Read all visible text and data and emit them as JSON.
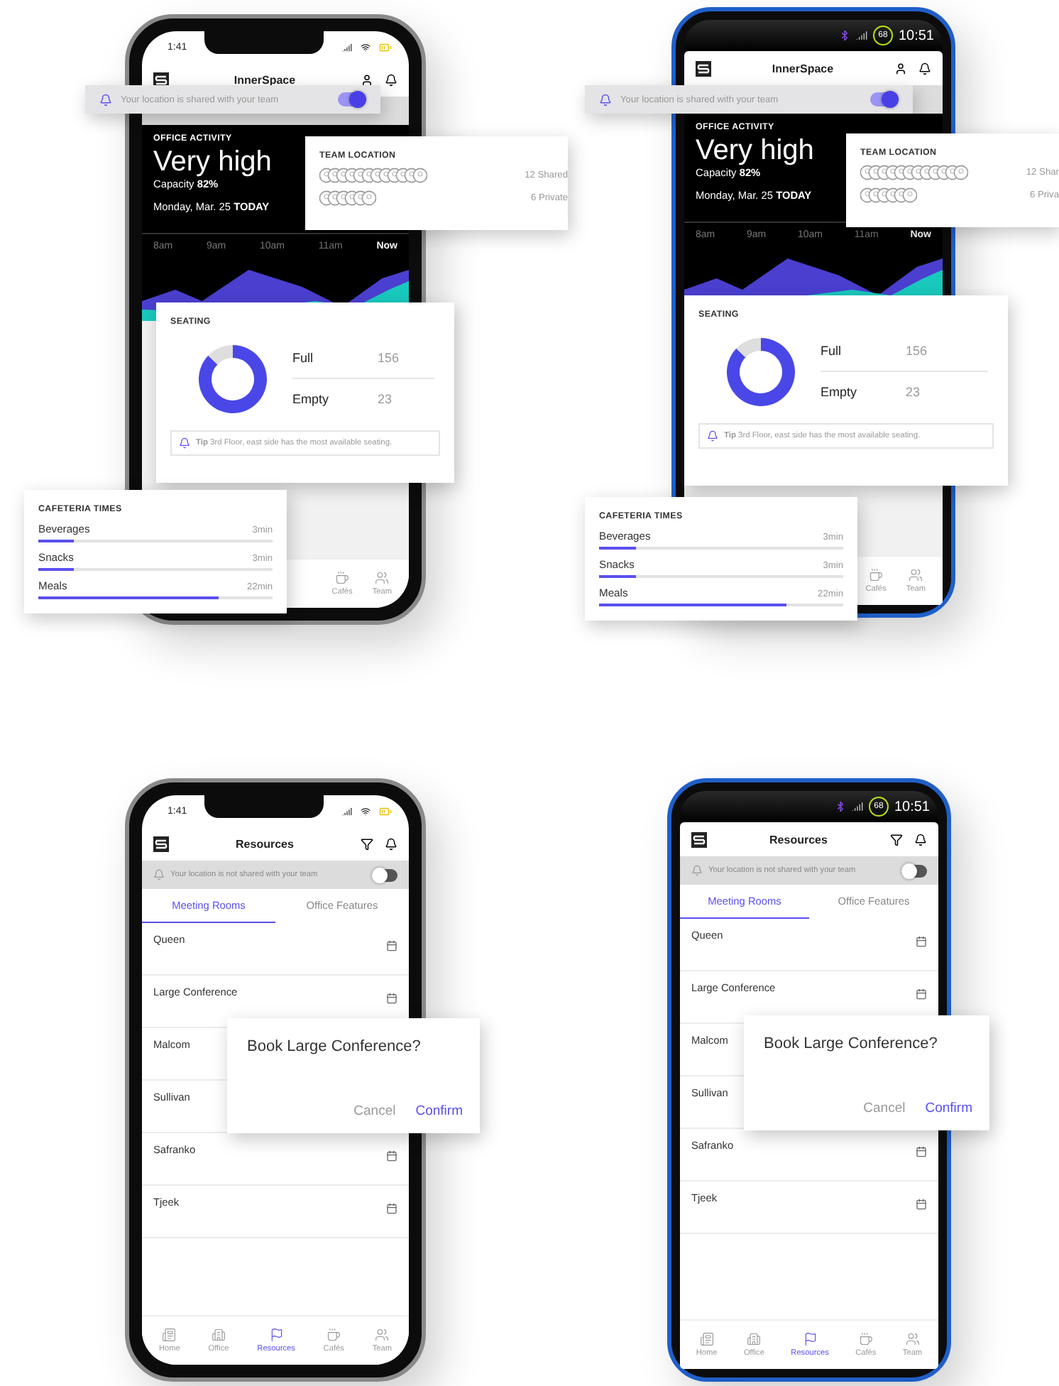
{
  "screens": [
    {
      "kind": "dashboard",
      "device": {
        "kind": "iphone"
      },
      "status_time": "1:41",
      "app_title": "InnerSpace",
      "share_banner": {
        "text": "Your location is shared with your team",
        "on": true
      },
      "activity": {
        "label": "OFFICE ACTIVITY",
        "value": "Very high",
        "capacity_label": "Capacity",
        "capacity": "82%",
        "date": "Monday, Mar. 25",
        "today": "TODAY",
        "hours": [
          "8am",
          "9am",
          "10am",
          "11am",
          "Now"
        ]
      },
      "team_location": {
        "title": "TEAM LOCATION",
        "groups": [
          "12 Shared",
          "6 Private"
        ]
      },
      "seating": {
        "title": "SEATING",
        "rows": [
          {
            "label": "Full",
            "value": "156"
          },
          {
            "label": "Empty",
            "value": "23"
          }
        ],
        "tip_label": "Tip",
        "tip": "3rd Floor, east side has the most available seating."
      },
      "cafeteria": {
        "title": "CAFETERIA TIMES",
        "items": [
          {
            "name": "Beverages",
            "time": "3min",
            "level": 0.15
          },
          {
            "name": "Snacks",
            "time": "3min",
            "level": 0.15
          },
          {
            "name": "Meals",
            "time": "22min",
            "level": 0.77
          }
        ]
      },
      "nav": [
        {
          "label": "Cafés",
          "selected": false
        },
        {
          "label": "Team",
          "selected": false
        }
      ]
    },
    {
      "kind": "dashboard",
      "device": {
        "kind": "android"
      },
      "status_time": "10:51",
      "battery": "68",
      "app_title": "InnerSpace",
      "share_banner": {
        "text": "Your location is shared with your team",
        "on": true
      },
      "activity": {
        "label": "OFFICE ACTIVITY",
        "value": "Very high",
        "capacity_label": "Capacity",
        "capacity": "82%",
        "date": "Monday, Mar. 25",
        "today": "TODAY",
        "hours": [
          "8am",
          "9am",
          "10am",
          "11am",
          "Now"
        ]
      },
      "team_location": {
        "title": "TEAM LOCATION",
        "groups": [
          "12 Shar",
          "6 Priva"
        ]
      },
      "seating": {
        "title": "SEATING",
        "rows": [
          {
            "label": "Full",
            "value": "156"
          },
          {
            "label": "Empty",
            "value": "23"
          }
        ],
        "tip_label": "Tip",
        "tip": "3rd Floor, east side has the most available seating."
      },
      "cafeteria": {
        "title": "CAFETERIA TIMES",
        "items": [
          {
            "name": "Beverages",
            "time": "3min",
            "level": 0.15
          },
          {
            "name": "Snacks",
            "time": "3min",
            "level": 0.15
          },
          {
            "name": "Meals",
            "time": "22min",
            "level": 0.77
          }
        ]
      },
      "nav": [
        {
          "label": "Cafés",
          "selected": false
        },
        {
          "label": "Team",
          "selected": false
        }
      ]
    },
    {
      "kind": "resources",
      "device": {
        "kind": "iphone"
      },
      "status_time": "1:41",
      "app_title": "Resources",
      "share_banner": {
        "text": "Your location is not shared with your team",
        "on": false
      },
      "tabs": [
        {
          "label": "Meeting Rooms",
          "selected": true
        },
        {
          "label": "Office Features",
          "selected": false
        }
      ],
      "rooms": [
        {
          "name": "Queen",
          "calendar": true
        },
        {
          "name": "Large Conference",
          "calendar": true
        },
        {
          "name": "Malcom",
          "calendar": false
        },
        {
          "name": "Sullivan",
          "calendar": false
        },
        {
          "name": "Safranko",
          "calendar": true
        },
        {
          "name": "Tjeek",
          "calendar": true
        }
      ],
      "dialog": {
        "title": "Book Large Conference?",
        "cancel": "Cancel",
        "confirm": "Confirm"
      },
      "nav": [
        {
          "label": "Home",
          "selected": false
        },
        {
          "label": "Office",
          "selected": false
        },
        {
          "label": "Resources",
          "selected": true
        },
        {
          "label": "Cafés",
          "selected": false
        },
        {
          "label": "Team",
          "selected": false
        }
      ]
    },
    {
      "kind": "resources",
      "device": {
        "kind": "android"
      },
      "status_time": "10:51",
      "battery": "68",
      "app_title": "Resources",
      "share_banner": {
        "text": "Your location is not shared with your team",
        "on": false
      },
      "tabs": [
        {
          "label": "Meeting Rooms",
          "selected": true
        },
        {
          "label": "Office Features",
          "selected": false
        }
      ],
      "rooms": [
        {
          "name": "Queen",
          "calendar": true
        },
        {
          "name": "Large Conference",
          "calendar": true
        },
        {
          "name": "Malcom",
          "calendar": false
        },
        {
          "name": "Sullivan",
          "calendar": false
        },
        {
          "name": "Safranko",
          "calendar": true
        },
        {
          "name": "Tjeek",
          "calendar": true
        }
      ],
      "dialog": {
        "title": "Book Large Conference?",
        "cancel": "Cancel",
        "confirm": "Confirm"
      },
      "nav": [
        {
          "label": "Home",
          "selected": false
        },
        {
          "label": "Office",
          "selected": false
        },
        {
          "label": "Resources",
          "selected": true
        },
        {
          "label": "Cafés",
          "selected": false
        },
        {
          "label": "Team",
          "selected": false
        }
      ]
    }
  ]
}
